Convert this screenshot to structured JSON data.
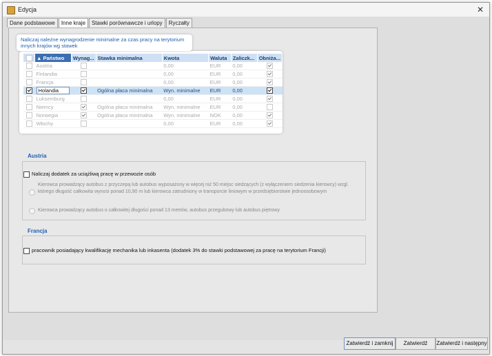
{
  "window": {
    "title": "Edycja",
    "close_icon": "close-icon",
    "app_icon": "folder-icon"
  },
  "tabs": [
    {
      "label": "Dane podstawowe",
      "active": false
    },
    {
      "label": "Inne kraje",
      "active": true
    },
    {
      "label": "Stawki porównawcze i urlopy",
      "active": false
    },
    {
      "label": "Ryczałty",
      "active": false
    }
  ],
  "callout": {
    "text": "Naliczaj należne wynagrodzenie minimalne za czas pracy na terytorium innych krajów wg stawek"
  },
  "grid": {
    "columns": [
      "",
      "▲ Państwo",
      "Wynag...",
      "Stawka minimalna",
      "Kwota",
      "Waluta",
      "Zaliczk...",
      "Obniża..."
    ],
    "rows": [
      {
        "check": false,
        "country": "Austria",
        "wynag": false,
        "stawka": "",
        "kwota": "0,00",
        "waluta": "EUR",
        "zaliczka": "0,00",
        "obniza": true,
        "selected": false
      },
      {
        "check": false,
        "country": "Finlandia",
        "wynag": false,
        "stawka": "",
        "kwota": "0,00",
        "waluta": "EUR",
        "zaliczka": "0,00",
        "obniza": true,
        "selected": false
      },
      {
        "check": false,
        "country": "Francja",
        "wynag": false,
        "stawka": "",
        "kwota": "0,00",
        "waluta": "EUR",
        "zaliczka": "0,00",
        "obniza": true,
        "selected": false
      },
      {
        "check": true,
        "country": "Holandia",
        "wynag": true,
        "stawka": "Ogólna płaca minimalna",
        "kwota": "Wyn. minimalne",
        "waluta": "EUR",
        "zaliczka": "0,00",
        "obniza": true,
        "selected": true
      },
      {
        "check": false,
        "country": "Luksemburg",
        "wynag": false,
        "stawka": "",
        "kwota": "0,00",
        "waluta": "EUR",
        "zaliczka": "0,00",
        "obniza": true,
        "selected": false
      },
      {
        "check": false,
        "country": "Niemcy",
        "wynag": true,
        "stawka": "Ogólna płaca minimalna",
        "kwota": "Wyn. minimalne",
        "waluta": "EUR",
        "zaliczka": "0,00",
        "obniza": false,
        "selected": false
      },
      {
        "check": false,
        "country": "Norwegia",
        "wynag": true,
        "stawka": "Ogólna płaca minimalna",
        "kwota": "Wyn. minimalne",
        "waluta": "NOK",
        "zaliczka": "0,00",
        "obniza": true,
        "selected": false
      },
      {
        "check": false,
        "country": "Włochy",
        "wynag": false,
        "stawka": "",
        "kwota": "0,00",
        "waluta": "EUR",
        "zaliczka": "0,00",
        "obniza": true,
        "selected": false
      }
    ]
  },
  "austria": {
    "title": "Austria",
    "checkbox_label": "Naliczaj dodatek za uciążliwą pracę w przewozie osób",
    "radio1": "Kierowca prowadzący autobus z przyczepą lub autobus wyposażony w więcej niż 50 miejsc siedzących (z wyłączeniem siedzenia kierowcy) wzgl. którego długość całkowita wynosi ponad 10,90 m lub kierowca zatrudniony w transporcie liniowym w przedsiębiorstwie jednoosobowym",
    "radio2": "Kierowca prowadzący autobus o całkowitej długości ponad 13 metrów, autobus przegubowy lub autobus piętrowy"
  },
  "francja": {
    "title": "Francja",
    "checkbox_label": "pracownik posiadający kwalifikację mechanika lub inkasenta (dodatek 3% do stawki podstawowej za pracę na terytorium Francji)"
  },
  "buttons": {
    "confirm_close": "Zatwierdź i zamknij",
    "confirm": "Zatwierdź",
    "confirm_next": "Zatwierdź i następny"
  }
}
